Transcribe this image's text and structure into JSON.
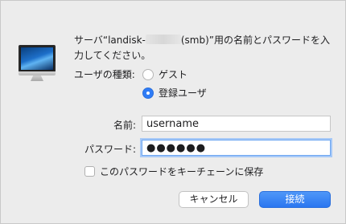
{
  "message": {
    "prefix": "サーバ“landisk-",
    "suffix": "(smb)”用の名前とパスワードを入",
    "line2": "力してください。"
  },
  "usertype": {
    "label": "ユーザの種類:",
    "options": [
      {
        "label": "ゲスト",
        "checked": false
      },
      {
        "label": "登録ユーザ",
        "checked": true
      }
    ]
  },
  "name": {
    "label": "名前:",
    "value": "username"
  },
  "password": {
    "label": "パスワード:",
    "value": "●●●●●●"
  },
  "save_password": {
    "label": "このパスワードをキーチェーンに保存",
    "checked": false
  },
  "buttons": {
    "cancel": "キャンセル",
    "connect": "接続"
  },
  "colors": {
    "accent": "#2f7cf6"
  }
}
